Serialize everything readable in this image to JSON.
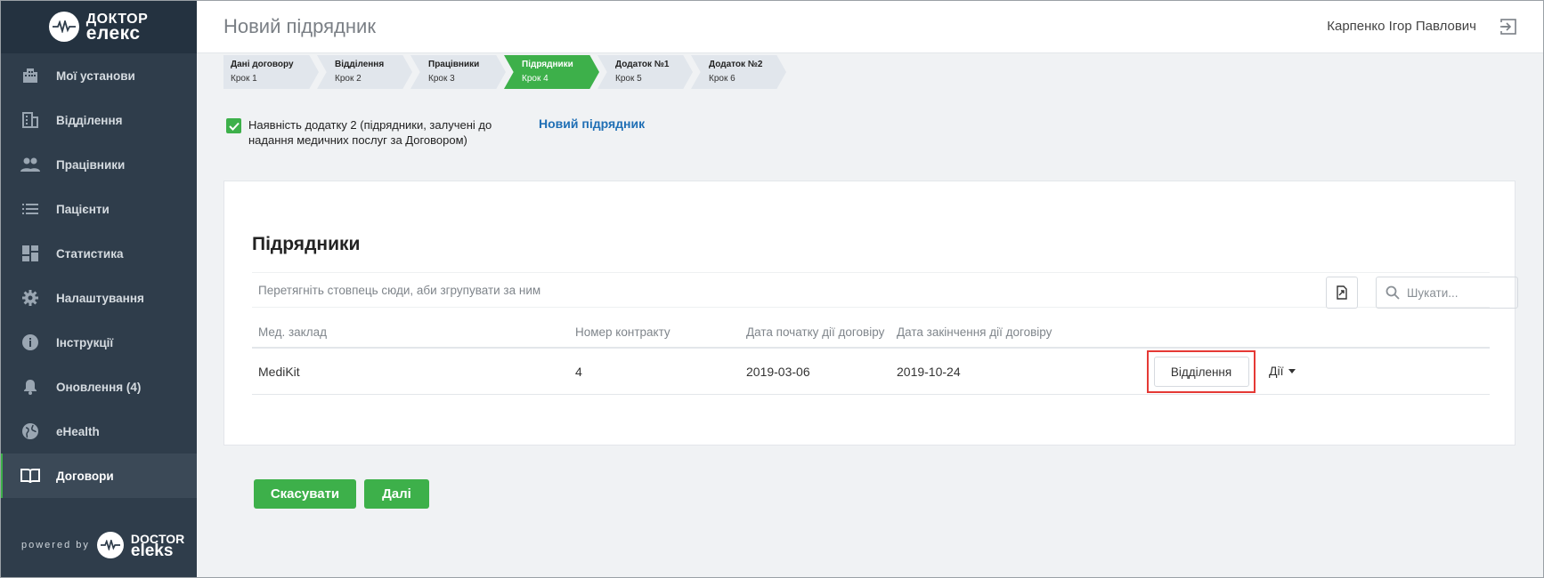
{
  "logo": {
    "line1": "ДОКТОР",
    "line2": "ЕЛЕКС"
  },
  "sidebar": {
    "items": [
      {
        "label": "Мої установи",
        "icon": "building-icon"
      },
      {
        "label": "Відділення",
        "icon": "office-icon"
      },
      {
        "label": "Працівники",
        "icon": "people-icon"
      },
      {
        "label": "Пацієнти",
        "icon": "list-icon"
      },
      {
        "label": "Статистика",
        "icon": "dashboard-icon"
      },
      {
        "label": "Налаштування",
        "icon": "gear-icon"
      },
      {
        "label": "Інструкції",
        "icon": "info-icon"
      },
      {
        "label": "Оновлення (4)",
        "icon": "bell-icon"
      },
      {
        "label": "eHealth",
        "icon": "globe-icon"
      },
      {
        "label": "Договори",
        "icon": "book-icon",
        "active": true
      }
    ],
    "powered_by": "powered by",
    "powered_logo_line1": "DOCTOR",
    "powered_logo_line2": "ELEKS"
  },
  "header": {
    "title": "Новий підрядник",
    "user": "Карпенко Ігор Павлович"
  },
  "steps": [
    {
      "name": "Дані договору",
      "step": "Крок 1"
    },
    {
      "name": "Відділення",
      "step": "Крок 2"
    },
    {
      "name": "Працівники",
      "step": "Крок 3"
    },
    {
      "name": "Підрядники",
      "step": "Крок 4",
      "active": true
    },
    {
      "name": "Додаток №1",
      "step": "Крок 5"
    },
    {
      "name": "Додаток №2",
      "step": "Крок 6"
    }
  ],
  "appendix": {
    "checked": true,
    "label": "Наявність додатку 2 (підрядники, залучені до надання медичних послуг за Договором)",
    "new_link": "Новий підрядник"
  },
  "grid": {
    "title": "Підрядники",
    "group_hint": "Перетягніть стовпець сюди, аби згрупувати за ним",
    "search_placeholder": "Шукати...",
    "columns": [
      "Мед. заклад",
      "Номер контракту",
      "Дата початку дії договіру",
      "Дата закінчення дії договіру"
    ],
    "rows": [
      {
        "facility": "MediKit",
        "contract": "4",
        "start": "2019-03-06",
        "end": "2019-10-24",
        "dept_button": "Відділення",
        "actions": "Дії"
      }
    ]
  },
  "footer": {
    "cancel": "Скасувати",
    "next": "Далі"
  },
  "colors": {
    "accent": "#3db04a",
    "sidebar": "#2f3d4b",
    "link": "#1f6fb5",
    "highlight": "#e53935"
  }
}
